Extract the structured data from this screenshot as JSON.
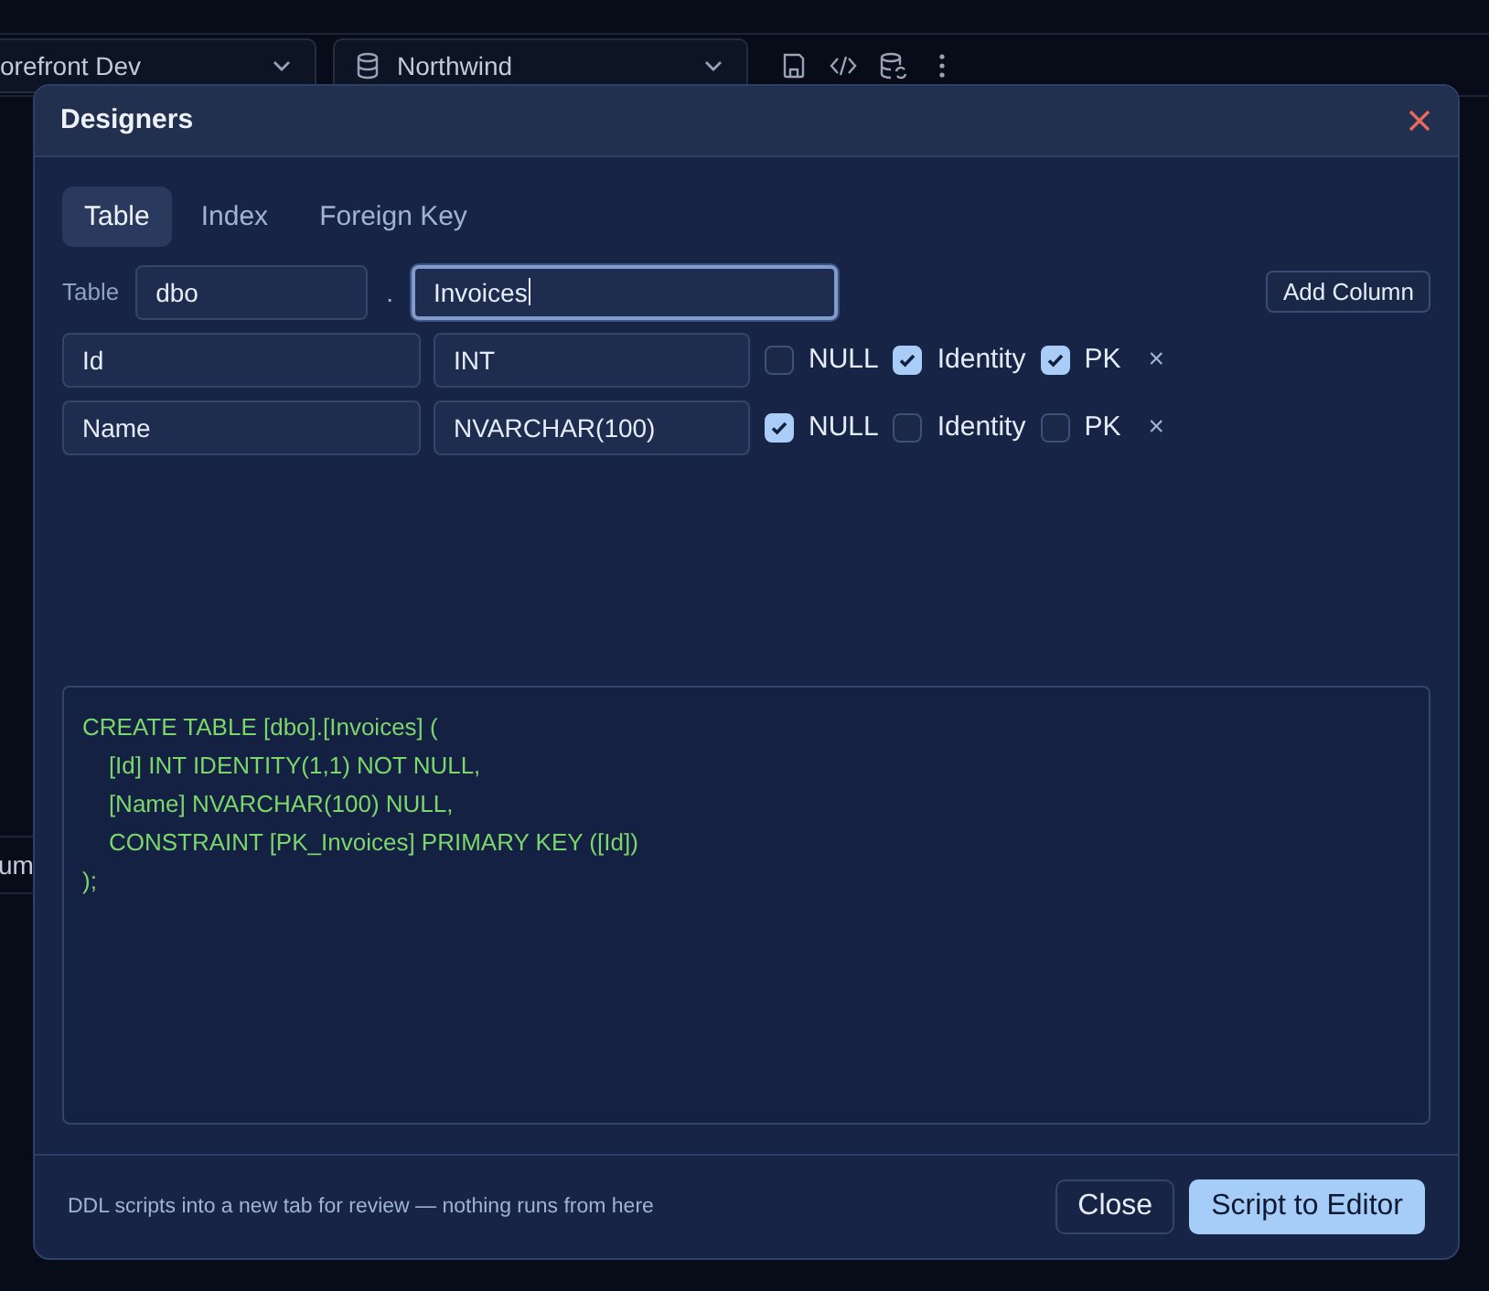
{
  "app": {
    "connection": "orefront Dev",
    "database": "Northwind",
    "panel_label": "um"
  },
  "dialog": {
    "title": "Designers",
    "tabs": [
      {
        "label": "Table",
        "selected": true
      },
      {
        "label": "Index",
        "selected": false
      },
      {
        "label": "Foreign Key",
        "selected": false
      }
    ],
    "table": {
      "label": "Table",
      "schema": "dbo",
      "separator": ".",
      "name": "Invoices",
      "focused": true
    },
    "add_column": "Add Column",
    "columns": [
      {
        "name": "Id",
        "type": "INT",
        "options": [
          {
            "label": "NULL",
            "checked": false
          },
          {
            "label": "Identity",
            "checked": true
          },
          {
            "label": "PK",
            "checked": true
          }
        ],
        "remove": "×"
      },
      {
        "name": "Name",
        "type": "NVARCHAR(100)",
        "options": [
          {
            "label": "NULL",
            "checked": true
          },
          {
            "label": "Identity",
            "checked": false
          },
          {
            "label": "PK",
            "checked": false
          }
        ],
        "remove": "×"
      }
    ],
    "script": [
      "CREATE TABLE [dbo].[Invoices] (",
      "    [Id] INT IDENTITY(1,1) NOT NULL,",
      "    [Name] NVARCHAR(100) NULL,",
      "    CONSTRAINT [PK_Invoices] PRIMARY KEY ([Id])",
      ");"
    ],
    "footer_note": "DDL scripts into a new tab for review — nothing runs from here",
    "buttons": [
      {
        "label": "Close",
        "kind": "secondary"
      },
      {
        "label": "Script to Editor",
        "kind": "primary"
      }
    ]
  }
}
